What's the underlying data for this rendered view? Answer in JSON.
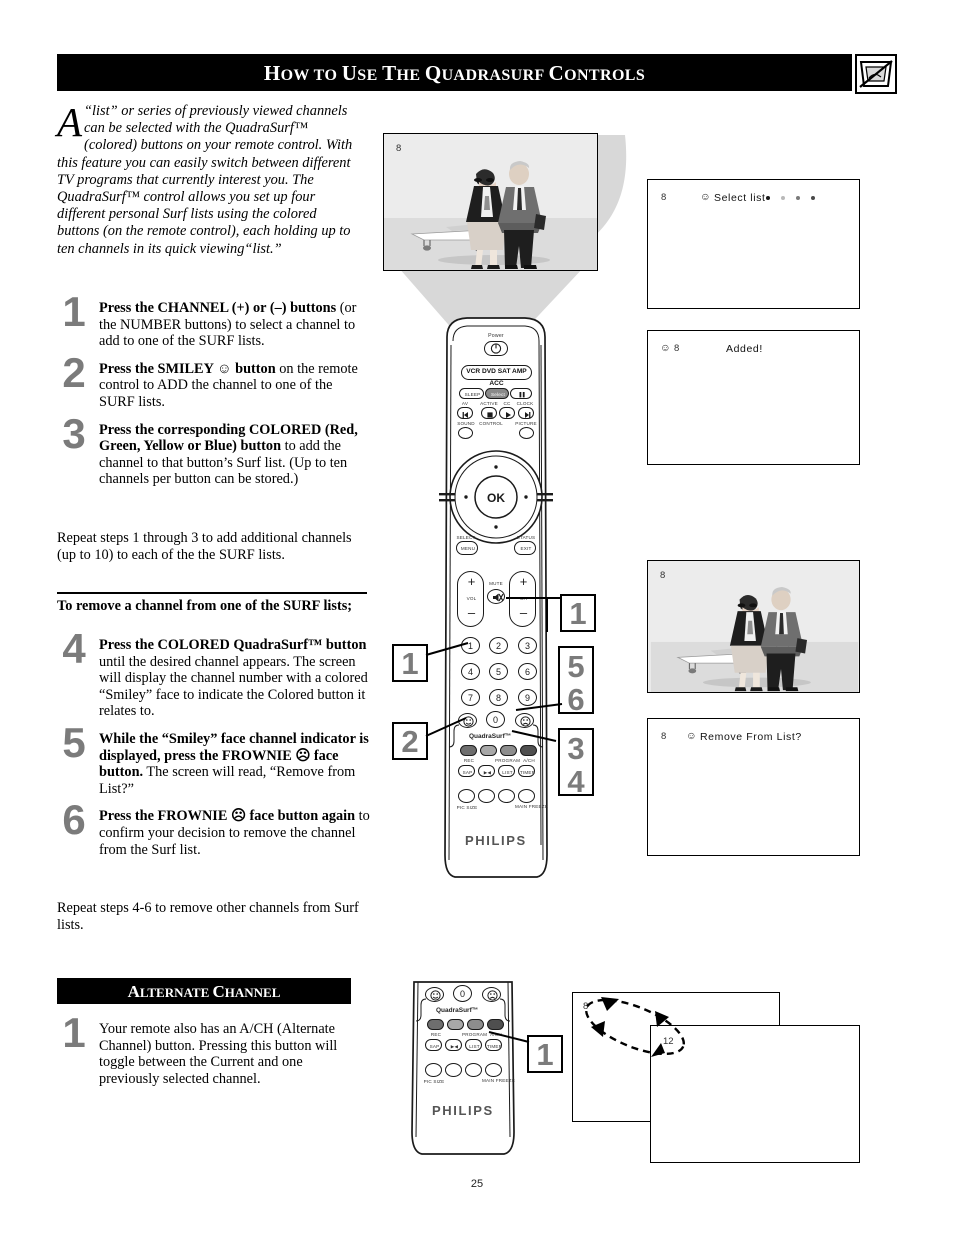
{
  "header": {
    "title_parts": [
      {
        "t": "H",
        "big": true
      },
      {
        "t": "OW",
        "big": false
      },
      {
        "t": " ",
        "big": false
      },
      {
        "t": "TO",
        "big": false
      },
      {
        "t": " ",
        "big": false
      },
      {
        "t": "U",
        "big": true
      },
      {
        "t": "SE",
        "big": false
      },
      {
        "t": " ",
        "big": false
      },
      {
        "t": "T",
        "big": true
      },
      {
        "t": "HE",
        "big": false
      },
      {
        "t": " ",
        "big": false
      },
      {
        "t": "Q",
        "big": true
      },
      {
        "t": "UADRASURF",
        "big": false
      },
      {
        "t": " ",
        "big": false
      },
      {
        "t": "C",
        "big": true
      },
      {
        "t": "ONTROLS",
        "big": false
      }
    ],
    "title_plain": "HOW TO USE THE QUADRASURF CONTROLS",
    "corner_icon": "tv-no-signal-icon"
  },
  "intro": {
    "dropcap": "A",
    "text": "“list” or series of previously viewed channels can be selected with the QuadraSurf™ (colored) buttons on your remote control. With this feature you can easily switch between different TV programs that currently interest you. The QuadraSurf™ control allows you set up four different personal Surf lists using the colored buttons (on the remote control), each holding up to ten channels in its quick viewing“list.”"
  },
  "steps": [
    {
      "num": "1",
      "bold": "Press the CHANNEL (+) or (–) buttons",
      "rest": " (or the NUMBER buttons) to select a channel to add to one of the SURF lists."
    },
    {
      "num": "2",
      "bold": "Press the SMILEY ☺ button",
      "rest": " on the remote control to ADD the channel to one of the SURF lists."
    },
    {
      "num": "3",
      "bold": "Press the corresponding COLORED (Red, Green, Yellow or Blue) button",
      "rest": " to add the channel to that button’s Surf list. (Up to ten channels per button can be stored.)"
    }
  ],
  "repeat_1_3": "Repeat steps 1 through 3 to add additional channels (up to 10) to each of the the SURF lists.",
  "remove_heading": "To remove a channel from one of the SURF lists;",
  "steps_remove": [
    {
      "num": "4",
      "bold": "Press the COLORED QuadraSurf™ button",
      "rest": " until the desired channel appears. The screen will display the channel number with a colored “Smiley” face to indicate the Colored button it relates to."
    },
    {
      "num": "5",
      "bold": "While the “Smiley” face channel indicator is displayed, press the FROWNIE ☹ face button.",
      "rest": " The screen will read, “Remove from List?”"
    },
    {
      "num": "6",
      "bold": "Press the FROWNIE ☹ face button again",
      "rest": " to confirm your decision to remove the channel from the Surf list."
    }
  ],
  "repeat_4_6": "Repeat steps 4-6 to remove other channels from Surf lists.",
  "alternate": {
    "title_plain": "ALTERNATE CHANNEL",
    "title_parts": [
      {
        "t": "A",
        "big": true
      },
      {
        "t": "LTERNATE",
        "big": false
      },
      {
        "t": " ",
        "big": false
      },
      {
        "t": "C",
        "big": true
      },
      {
        "t": "HANNEL",
        "big": false
      }
    ],
    "step": {
      "num": "1",
      "text": "Your remote also has an A/CH (Alternate Channel) button. Pressing this button will toggle between the Current and one previously selected channel."
    }
  },
  "screens": {
    "tv_top": {
      "channel": "8"
    },
    "select_list": {
      "channel": "8",
      "face": "☺",
      "label": "Select list",
      "dots": [
        "#1a1a1a",
        "#b9b9b9",
        "#7a7a7a",
        "#4a4a4a"
      ]
    },
    "added": {
      "face": "☺",
      "channel": "8",
      "label": "Added!"
    },
    "tv_lower": {
      "channel": "8"
    },
    "remove": {
      "channel": "8",
      "face": "☺",
      "label": "Remove From List?"
    },
    "alt_tv_a": {
      "channel": "8"
    },
    "alt_tv_b": {
      "channel": "12"
    }
  },
  "remote": {
    "brand": "PHILIPS",
    "power_label": "Power",
    "power_icon": "power-icon",
    "mode_bar": "VCR DVD SAT AMP ACC",
    "sleep": "SLEEP",
    "select": "Select",
    "pause_icon": "pause-icon",
    "sub_labels_row1": [
      "AV",
      "ACTIVE",
      "CC",
      "CLOCK"
    ],
    "transport_icons": [
      "prev-icon",
      "stop-icon",
      "play-icon",
      "next-icon"
    ],
    "sub_labels_row2": [
      "SOUND",
      "CONTROL",
      "PICTURE"
    ],
    "ok": "OK",
    "menu": "MENU",
    "exit": "EXIT",
    "menu_top": "SELECT",
    "exit_top": "STATUS",
    "vol": "VOL",
    "ch": "CH",
    "mute": "MUTE",
    "mute_icon": "mute-icon",
    "plus": "+",
    "minus": "–",
    "keys": [
      "1",
      "2",
      "3",
      "4",
      "5",
      "6",
      "7",
      "8",
      "9",
      "0"
    ],
    "smiley": "☺",
    "frownie": "☹",
    "quadrasurf": "QuadraSurf™",
    "color_buttons": [
      "#6e6e6e",
      "#a8a8a8",
      "#8d8d8d",
      "#4f4f4f"
    ],
    "color_sub": [
      "REC",
      "",
      "PROGRAM",
      "A/CH"
    ],
    "row_sap": [
      "SAP",
      "▶◀",
      "LIST",
      "TIMER"
    ],
    "row_bottom_labels": [
      "PIC SIZE",
      "",
      "",
      "MAIN FREEZE"
    ]
  },
  "callouts": {
    "ch_plus": "1",
    "numbers": "1",
    "smiley": "2",
    "five": "5",
    "six": "6",
    "three": "3",
    "four": "4",
    "alt": "1"
  },
  "page_number": "25"
}
